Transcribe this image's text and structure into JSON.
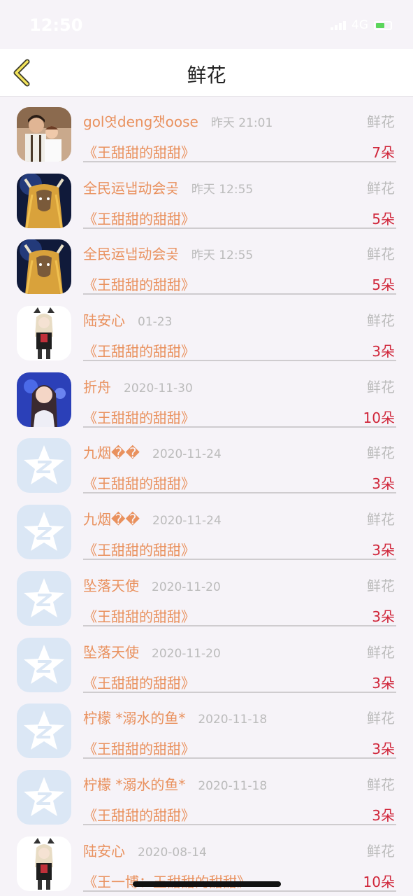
{
  "status_bar": {
    "time": "12:50",
    "network": "4G"
  },
  "nav": {
    "title": "鲜花"
  },
  "rows": [
    {
      "name": "gol엿deng잿oose",
      "date": "昨天 21:01",
      "type": "鲜花",
      "book": "《王甜甜的甜甜》",
      "count": "7朵",
      "avatar": "photo-couple"
    },
    {
      "name": "全民运냅动会곶",
      "date": "昨天 12:55",
      "type": "鲜花",
      "book": "《王甜甜的甜甜》",
      "count": "5朵",
      "avatar": "game-character"
    },
    {
      "name": "全民运냅动会곶",
      "date": "昨天 12:55",
      "type": "鲜花",
      "book": "《王甜甜的甜甜》",
      "count": "5朵",
      "avatar": "game-character"
    },
    {
      "name": "陆安心",
      "date": "01-23",
      "type": "鲜花",
      "book": "《王甜甜的甜甜》",
      "count": "3朵",
      "avatar": "anime-girl"
    },
    {
      "name": "折舟",
      "date": "2020-11-30",
      "type": "鲜花",
      "book": "《王甜甜的甜甜》",
      "count": "10朵",
      "avatar": "singer-photo"
    },
    {
      "name": "九烟��",
      "date": "2020-11-24",
      "type": "鲜花",
      "book": "《王甜甜的甜甜》",
      "count": "3朵",
      "avatar": "default-star"
    },
    {
      "name": "九烟��",
      "date": "2020-11-24",
      "type": "鲜花",
      "book": "《王甜甜的甜甜》",
      "count": "3朵",
      "avatar": "default-star"
    },
    {
      "name": "坠落天使",
      "date": "2020-11-20",
      "type": "鲜花",
      "book": "《王甜甜的甜甜》",
      "count": "3朵",
      "avatar": "default-star"
    },
    {
      "name": "坠落天使",
      "date": "2020-11-20",
      "type": "鲜花",
      "book": "《王甜甜的甜甜》",
      "count": "3朵",
      "avatar": "default-star"
    },
    {
      "name": "柠檬 *溺水的鱼*",
      "date": "2020-11-18",
      "type": "鲜花",
      "book": "《王甜甜的甜甜》",
      "count": "3朵",
      "avatar": "default-star"
    },
    {
      "name": "柠檬 *溺水的鱼*",
      "date": "2020-11-18",
      "type": "鲜花",
      "book": "《王甜甜的甜甜》",
      "count": "3朵",
      "avatar": "default-star"
    },
    {
      "name": "陆安心",
      "date": "2020-08-14",
      "type": "鲜花",
      "book": "《王一博：王甜甜的甜甜》",
      "count": "10朵",
      "avatar": "anime-girl"
    }
  ]
}
